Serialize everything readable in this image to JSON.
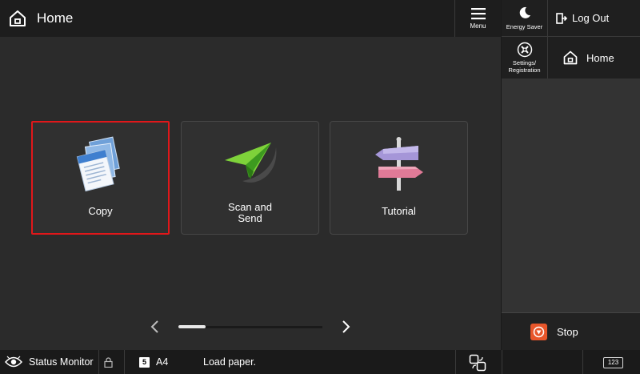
{
  "header": {
    "title": "Home",
    "menu_label": "Menu"
  },
  "tiles": [
    {
      "id": "copy",
      "label": "Copy",
      "selected": true
    },
    {
      "id": "scan",
      "label": "Scan and\nSend",
      "selected": false
    },
    {
      "id": "tutorial",
      "label": "Tutorial",
      "selected": false
    }
  ],
  "pager": {
    "position_fraction": 0.19
  },
  "right_panel": {
    "energy_saver_label": "Energy Saver",
    "log_out_label": "Log Out",
    "settings_label": "Settings/\nRegistration",
    "home_label": "Home",
    "stop_label": "Stop"
  },
  "status_bar": {
    "status_monitor_label": "Status Monitor",
    "tray_number": "5",
    "paper_size": "A4",
    "message": "Load paper.",
    "keypad_label": "123"
  },
  "colors": {
    "selected_border": "#e0171a",
    "stop_orange": "#e8562a",
    "background": "#2b2b2b"
  },
  "icons": {
    "home": "home-icon",
    "menu": "hamburger-menu-icon",
    "energy": "moon-icon",
    "logout": "logout-door-icon",
    "settings": "settings-wrench-icon",
    "stop": "stop-hand-icon",
    "status": "eye-icon",
    "lock": "lock-icon",
    "device": "device-connect-icon"
  }
}
